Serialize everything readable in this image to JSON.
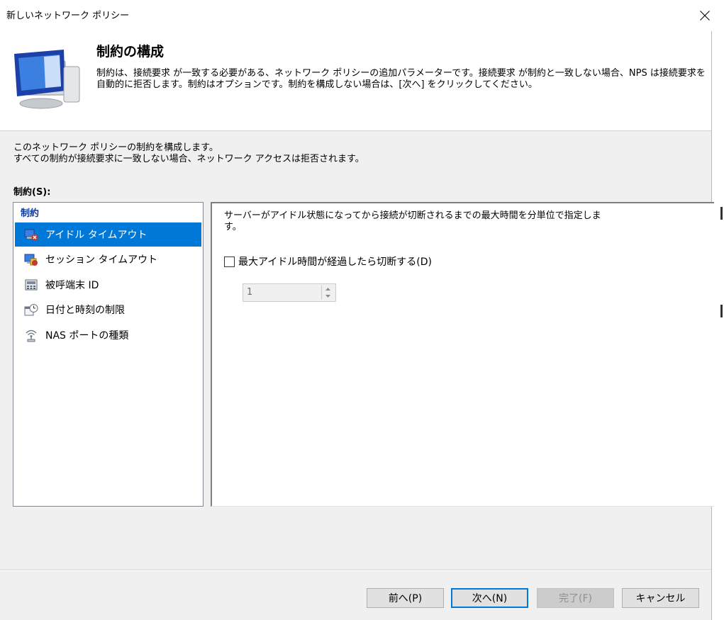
{
  "window": {
    "title": "新しいネットワーク ポリシー",
    "close_icon": "close-icon"
  },
  "header": {
    "title": "制約の構成",
    "description": "制約は、接続要求 が一致する必要がある、ネットワーク ポリシーの追加パラメーターです。接続要求 が制約と一致しない場合、NPS は接続要求を自動的に拒否します。制約はオプションです。制約を構成しない場合は、[次へ] をクリックしてください。",
    "icon": "network-monitor-icon"
  },
  "main": {
    "intro_line1": "このネットワーク ポリシーの制約を構成します。",
    "intro_line2": "すべての制約が接続要求に一致しない場合、ネットワーク アクセスは拒否されます。",
    "constraints_label": "制約(S):",
    "list_header": "制約",
    "items": [
      {
        "label": "アイドル タイムアウト",
        "icon": "idle-timeout-icon",
        "selected": true
      },
      {
        "label": "セッション タイムアウト",
        "icon": "session-timeout-icon",
        "selected": false
      },
      {
        "label": "被呼端末 ID",
        "icon": "called-station-id-icon",
        "selected": false
      },
      {
        "label": "日付と時刻の制限",
        "icon": "day-time-restriction-icon",
        "selected": false
      },
      {
        "label": "NAS ポートの種類",
        "icon": "nas-port-type-icon",
        "selected": false
      }
    ]
  },
  "panel": {
    "description_line1": "サーバーがアイドル状態になってから接続が切断されるまでの最大時間を分単位で指定しま",
    "description_line2": "す。",
    "checkbox_label": "最大アイドル時間が経過したら切断する(D)",
    "checkbox_checked": false,
    "spinner_value": "1"
  },
  "footer": {
    "back_label": "前へ(P)",
    "next_label": "次へ(N)",
    "finish_label": "完了(F)",
    "cancel_label": "キャンセル"
  },
  "colors": {
    "selection": "#0078d7",
    "list_header": "#0a3aa0"
  }
}
